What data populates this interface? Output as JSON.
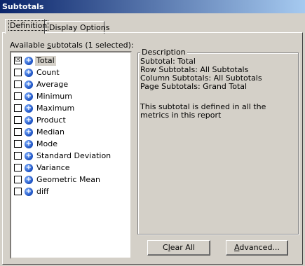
{
  "window": {
    "title": "Subtotals"
  },
  "tabs": [
    {
      "label": "Definition",
      "active": true
    },
    {
      "label": "Display Options",
      "active": false
    }
  ],
  "list": {
    "label_prefix": "Available ",
    "label_underline": "s",
    "label_suffix": "ubtotals (1 selected):",
    "items": [
      {
        "label": "Total",
        "checked": true,
        "selected": true,
        "check_mark": "☒"
      },
      {
        "label": "Count",
        "checked": false
      },
      {
        "label": "Average",
        "checked": false
      },
      {
        "label": "Minimum",
        "checked": false
      },
      {
        "label": "Maximum",
        "checked": false
      },
      {
        "label": "Product",
        "checked": false
      },
      {
        "label": "Median",
        "checked": false
      },
      {
        "label": "Mode",
        "checked": false
      },
      {
        "label": "Standard Deviation",
        "checked": false
      },
      {
        "label": "Variance",
        "checked": false
      },
      {
        "label": "Geometric Mean",
        "checked": false
      },
      {
        "label": "diff",
        "checked": false
      }
    ]
  },
  "description": {
    "title": "Description",
    "lines": [
      "Subtotal: Total",
      "Row Subtotals: All Subtotals",
      "Column Subtotals: All Subtotals",
      "Page Subtotals: Grand Total"
    ],
    "note": "This subtotal is defined in all the metrics in this report"
  },
  "buttons": {
    "clear_all_prefix": "C",
    "clear_all_underline": "l",
    "clear_all_suffix": "ear All",
    "advanced_underline": "A",
    "advanced_suffix": "dvanced..."
  },
  "icons": {
    "metric": "metric-plus-icon",
    "checkbox": "checkbox-icon"
  },
  "colors": {
    "titlebar_start": "#0a246a",
    "titlebar_end": "#a6caf0",
    "face": "#d4d0c8"
  }
}
